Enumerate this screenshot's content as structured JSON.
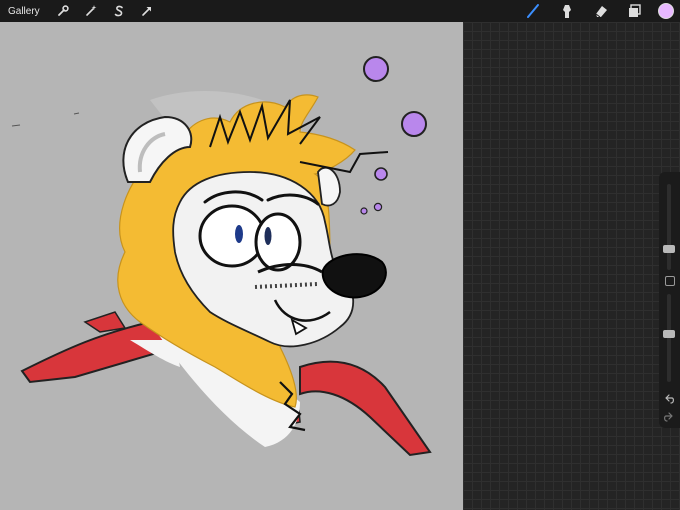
{
  "topbar": {
    "gallery_label": "Gallery",
    "left_tools": [
      "wrench-icon",
      "magic-wand-icon",
      "selection-s-icon",
      "transform-arrow-icon"
    ],
    "right_tools": [
      "brush-icon",
      "smudge-icon",
      "eraser-icon",
      "layers-icon"
    ],
    "active_tool": "brush-icon",
    "accent_color": "#3b8fff",
    "current_color": "#e8b8ff"
  },
  "sidebar": {
    "brush_size_level": 0.25,
    "opacity_level": 0.55,
    "undo_icon": "undo-icon",
    "redo_icon": "redo-icon"
  },
  "canvas": {
    "background": "#b5b5b5",
    "ink_colors": [
      "#f4bb33",
      "#d8363b",
      "#ffffff",
      "#111111",
      "#b987ec"
    ]
  }
}
